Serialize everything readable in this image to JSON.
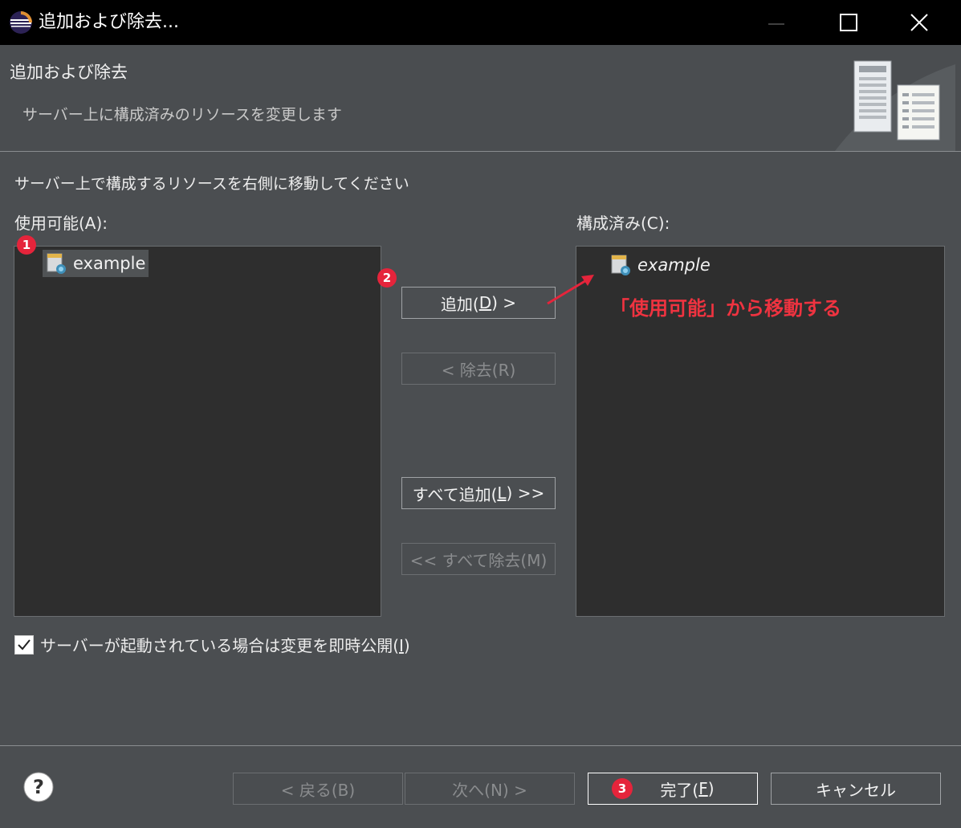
{
  "window": {
    "title": "追加および除去..."
  },
  "banner": {
    "title": "追加および除去",
    "description": "サーバー上に構成済みのリソースを変更します"
  },
  "instruction": "サーバー上で構成するリソースを右側に移動してください",
  "available": {
    "label": "使用可能(A):",
    "items": [
      "example"
    ]
  },
  "configured": {
    "label": "構成済み(C):",
    "items": [
      "example"
    ]
  },
  "buttons": {
    "add_prefix": "追加(",
    "add_mnemonic": "D",
    "add_suffix": ") >",
    "remove": "< 除去(R)",
    "add_all_prefix": "すべて追加(",
    "add_all_mnemonic": "L",
    "add_all_suffix": ") >>",
    "remove_all": "<< すべて除去(M)"
  },
  "publish_checkbox": {
    "checked": true,
    "label_prefix": "サーバーが起動されている場合は変更を即時公開(",
    "label_mnemonic": "I",
    "label_suffix": ")"
  },
  "footer": {
    "back": "< 戻る(B)",
    "next": "次へ(N) >",
    "finish_prefix": "完了(",
    "finish_mnemonic": "F",
    "finish_suffix": ")",
    "cancel": "キャンセル"
  },
  "annotations": {
    "badge_1": "1",
    "badge_2": "2",
    "badge_3": "3",
    "note": "「使用可能」から移動する",
    "color": "#e5243b"
  }
}
